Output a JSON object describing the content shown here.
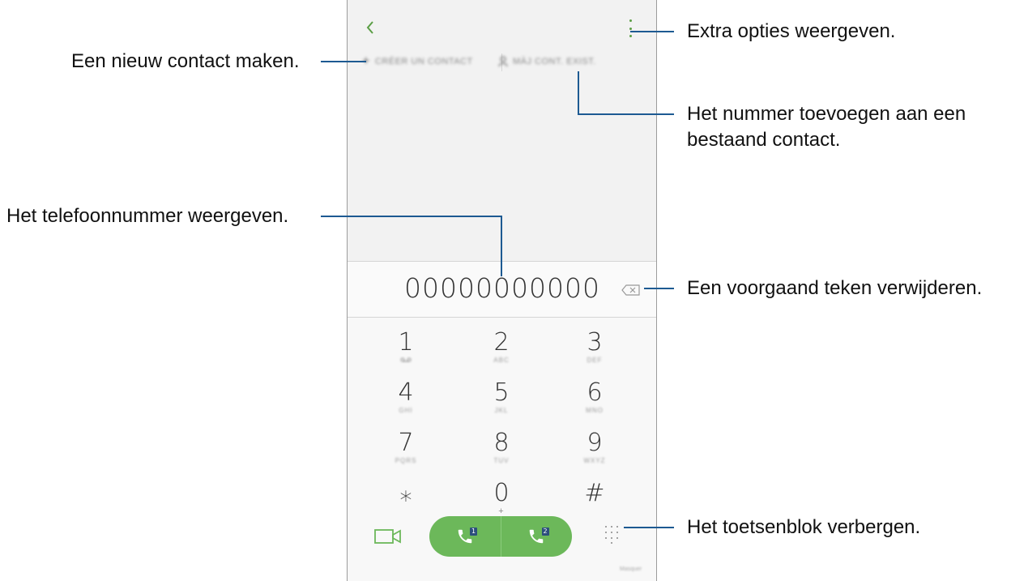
{
  "annotations": {
    "create_contact": "Een nieuw contact maken.",
    "more_options": "Extra opties weergeven.",
    "add_to_existing_line1": "Het nummer toevoegen aan een",
    "add_to_existing_line2": "bestaand contact.",
    "show_number": "Het telefoonnummer weergeven.",
    "delete_char": "Een voorgaand teken verwijderen.",
    "hide_keypad": "Het toetsenblok verbergen."
  },
  "phone": {
    "back_icon": "chevron-left-icon",
    "more_icon": "more-vertical-icon",
    "create_contact_label": "CRÉER UN CONTACT",
    "update_contact_label": "MÀJ CONT. EXIST.",
    "number": "00000000000",
    "keys": [
      {
        "digit": "1",
        "sub": ""
      },
      {
        "digit": "2",
        "sub": "ABC"
      },
      {
        "digit": "3",
        "sub": "DEF"
      },
      {
        "digit": "4",
        "sub": "GHI"
      },
      {
        "digit": "5",
        "sub": "JKL"
      },
      {
        "digit": "6",
        "sub": "MNO"
      },
      {
        "digit": "7",
        "sub": "PQRS"
      },
      {
        "digit": "8",
        "sub": "TUV"
      },
      {
        "digit": "9",
        "sub": "WXYZ"
      },
      {
        "digit": "⁎",
        "sub": ""
      },
      {
        "digit": "0",
        "sub": "+"
      },
      {
        "digit": "#",
        "sub": ""
      }
    ],
    "sim1": "1",
    "sim2": "2",
    "hide_label": "Masquer",
    "accent_color": "#6cb85a",
    "line_color": "#1d5a92"
  }
}
